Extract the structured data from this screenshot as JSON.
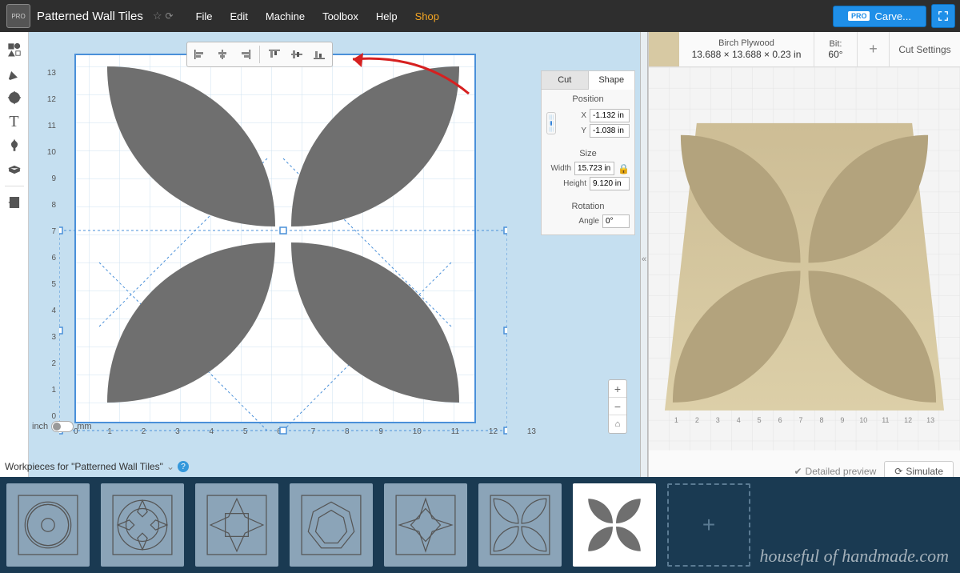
{
  "header": {
    "logo_badge": "PRO",
    "title": "Patterned Wall Tiles",
    "menu": [
      "File",
      "Edit",
      "Machine",
      "Toolbox",
      "Help"
    ],
    "shop": "Shop",
    "carve_badge": "PRO",
    "carve_label": "Carve..."
  },
  "toolbox": {
    "tools": [
      "shapes",
      "pen",
      "drill",
      "text",
      "apps",
      "bricks",
      "import"
    ]
  },
  "align_toolbar": {
    "items": [
      "align-left",
      "align-center-h",
      "align-right",
      "align-top",
      "align-center-v",
      "align-bottom"
    ]
  },
  "shape_panel": {
    "tab_cut": "Cut",
    "tab_shape": "Shape",
    "position_title": "Position",
    "x_label": "X",
    "x_value": "-1.132 in",
    "y_label": "Y",
    "y_value": "-1.038 in",
    "size_title": "Size",
    "width_label": "Width",
    "width_value": "15.723 in",
    "height_label": "Height",
    "height_value": "9.120 in",
    "rotation_title": "Rotation",
    "angle_label": "Angle",
    "angle_value": "0°"
  },
  "ruler": {
    "x": [
      "0",
      "1",
      "2",
      "3",
      "4",
      "5",
      "6",
      "7",
      "8",
      "9",
      "10",
      "11",
      "12",
      "13"
    ],
    "y": [
      "0",
      "1",
      "2",
      "3",
      "4",
      "5",
      "6",
      "7",
      "8",
      "9",
      "10",
      "11",
      "12",
      "13"
    ]
  },
  "units": {
    "inch": "inch",
    "mm": "mm"
  },
  "preview": {
    "material_name": "Birch Plywood",
    "material_dims": "13.688 × 13.688 × 0.23 in",
    "bit_label": "Bit:",
    "bit_value": "60°",
    "cut_settings": "Cut Settings",
    "detailed": "Detailed preview",
    "simulate": "Simulate",
    "ruler": [
      "1",
      "2",
      "3",
      "4",
      "5",
      "6",
      "7",
      "8",
      "9",
      "10",
      "11",
      "12",
      "13"
    ]
  },
  "workpieces": {
    "title": "Workpieces for \"Patterned Wall Tiles\"",
    "count": 7
  },
  "watermark": "houseful of handmade.com"
}
